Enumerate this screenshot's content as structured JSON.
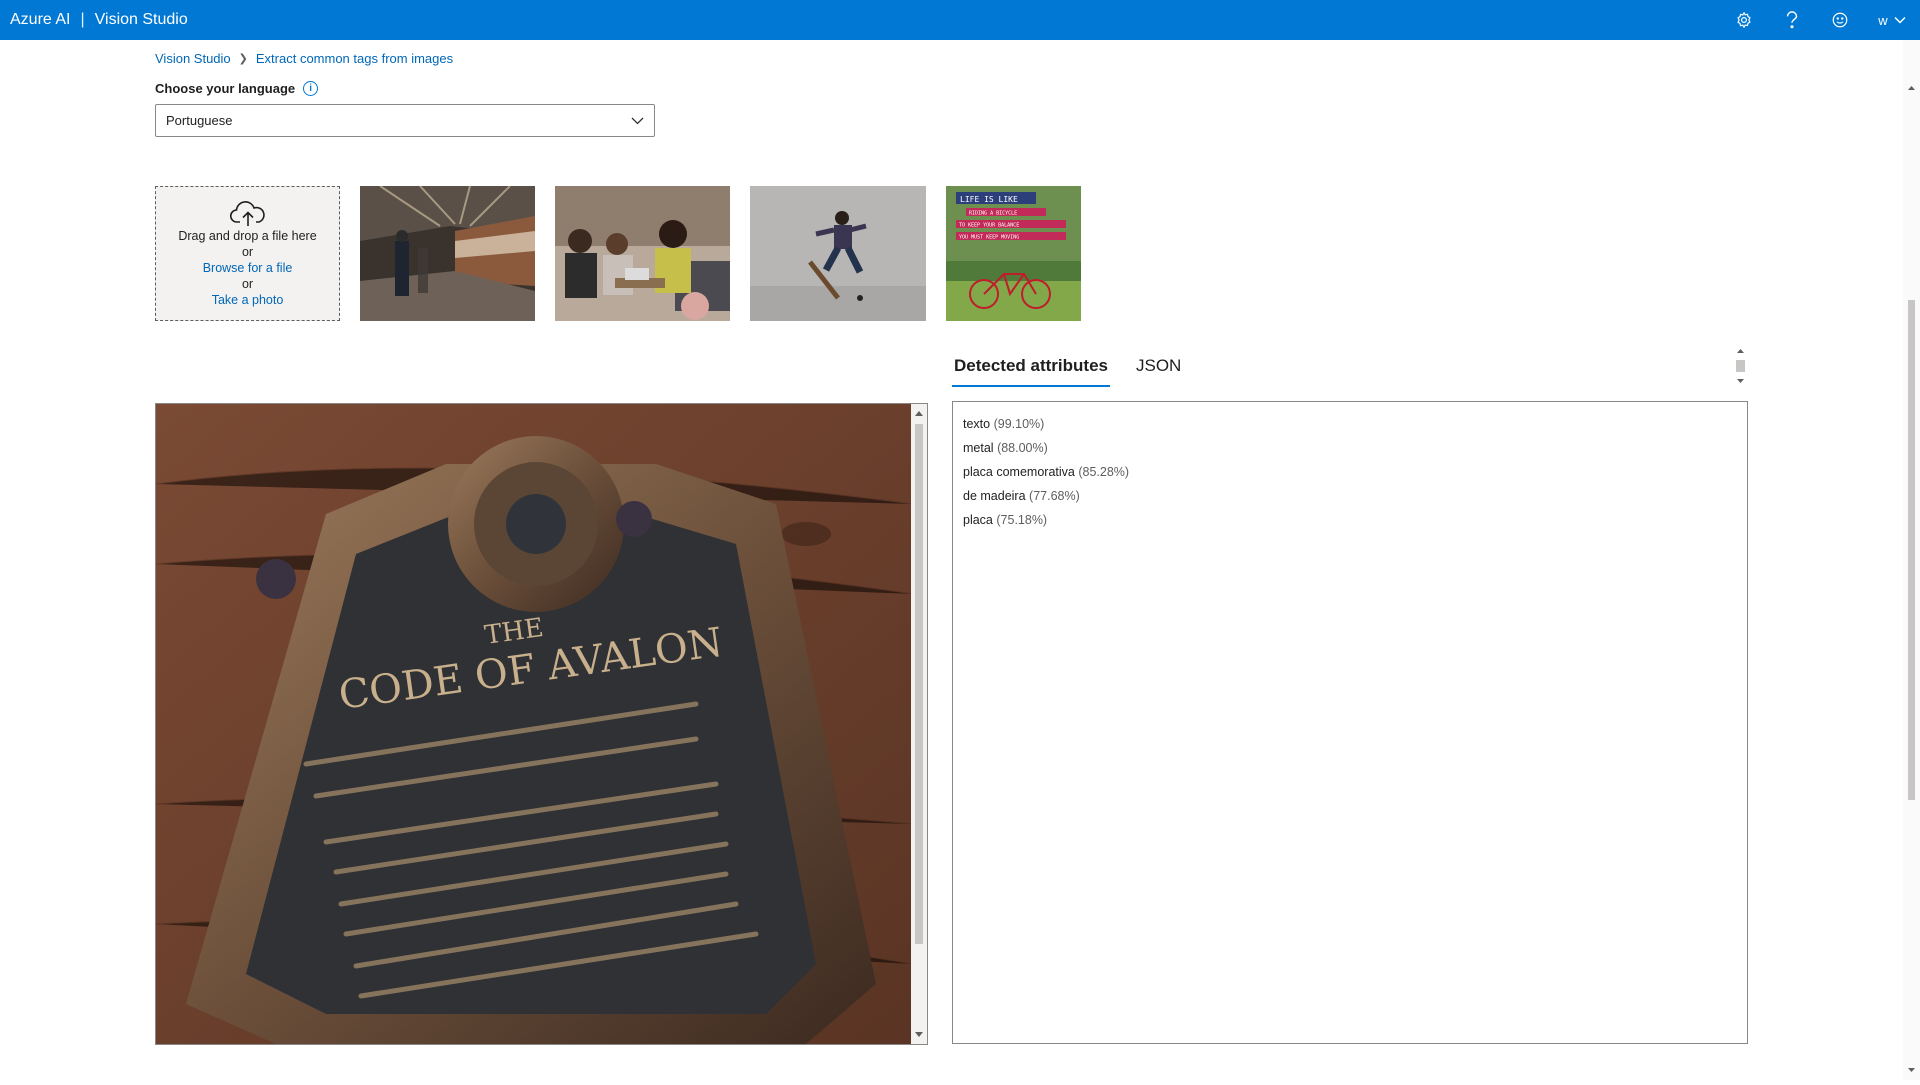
{
  "header": {
    "brand_primary": "Azure AI",
    "brand_secondary": "Vision Studio",
    "user_initial": "w",
    "icons": [
      "gear-icon",
      "help-icon",
      "smiley-icon",
      "chevron-down-icon"
    ]
  },
  "breadcrumb": {
    "items": [
      "Vision Studio",
      "Extract common tags from images"
    ]
  },
  "language": {
    "label": "Choose your language",
    "selected": "Portuguese"
  },
  "upload": {
    "drag_text": "Drag and drop a file here",
    "or_1": "or",
    "browse_link": "Browse for a file",
    "or_2": "or",
    "photo_link": "Take a photo"
  },
  "samples": {
    "images": [
      "subway-station-photo",
      "people-meeting-photo",
      "skateboarder-photo",
      "bicycle-poster-photo"
    ],
    "poster_text": [
      "LIFE IS LIKE",
      "RIDING A BICYCLE",
      "TO KEEP YOUR BALANCE",
      "YOU MUST KEEP MOVING"
    ]
  },
  "tabs": [
    {
      "label": "Detected attributes",
      "active": true
    },
    {
      "label": "JSON",
      "active": false
    }
  ],
  "preview": {
    "plaque_title_1": "THE",
    "plaque_title_2": "CODE OF AVALON"
  },
  "results": [
    {
      "tag": "texto",
      "confidence": "(99.10%)"
    },
    {
      "tag": "metal",
      "confidence": "(88.00%)"
    },
    {
      "tag": "placa comemorativa",
      "confidence": "(85.28%)"
    },
    {
      "tag": "de madeira",
      "confidence": "(77.68%)"
    },
    {
      "tag": "placa",
      "confidence": "(75.18%)"
    }
  ],
  "colors": {
    "accent": "#0078d4",
    "link": "#0067b8",
    "border": "#8a8886"
  }
}
